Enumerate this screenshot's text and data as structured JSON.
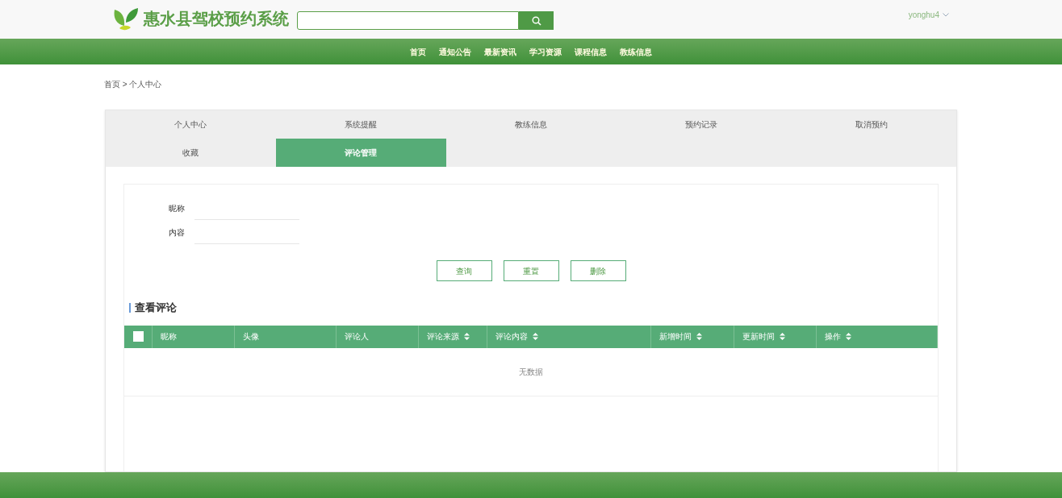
{
  "header": {
    "site_title": "惠水县驾校预约系统",
    "user": "yonghu4"
  },
  "nav": [
    {
      "label": "首页"
    },
    {
      "label": "通知公告"
    },
    {
      "label": "最新资讯"
    },
    {
      "label": "学习资源"
    },
    {
      "label": "课程信息"
    },
    {
      "label": "教练信息"
    }
  ],
  "breadcrumb": "首页 > 个人中心",
  "tabs": [
    {
      "label": "个人中心",
      "selected": false
    },
    {
      "label": "系统提醒",
      "selected": false
    },
    {
      "label": "教练信息",
      "selected": false
    },
    {
      "label": "预约记录",
      "selected": false
    },
    {
      "label": "取消预约",
      "selected": false
    },
    {
      "label": "收藏",
      "selected": false
    },
    {
      "label": "评论管理",
      "selected": true
    }
  ],
  "filters": [
    {
      "label": "昵称"
    },
    {
      "label": "内容"
    }
  ],
  "buttons": [
    "查询",
    "重置",
    "删除"
  ],
  "section_title": "查看评论",
  "table": {
    "select_all": {
      "checked": false
    },
    "columns": [
      {
        "label": "昵称",
        "kind": "plain"
      },
      {
        "label": "头像",
        "kind": "plain"
      },
      {
        "label": "评论人",
        "kind": "plain"
      },
      {
        "label": "评论来源",
        "kind": "sortable"
      },
      {
        "label": "评论内容",
        "kind": "sortable"
      },
      {
        "label": "新增时间",
        "kind": "sortable"
      },
      {
        "label": "更新时间",
        "kind": "sortable"
      },
      {
        "label": "操作",
        "kind": "sortable"
      }
    ],
    "empty_text": "无数据"
  }
}
